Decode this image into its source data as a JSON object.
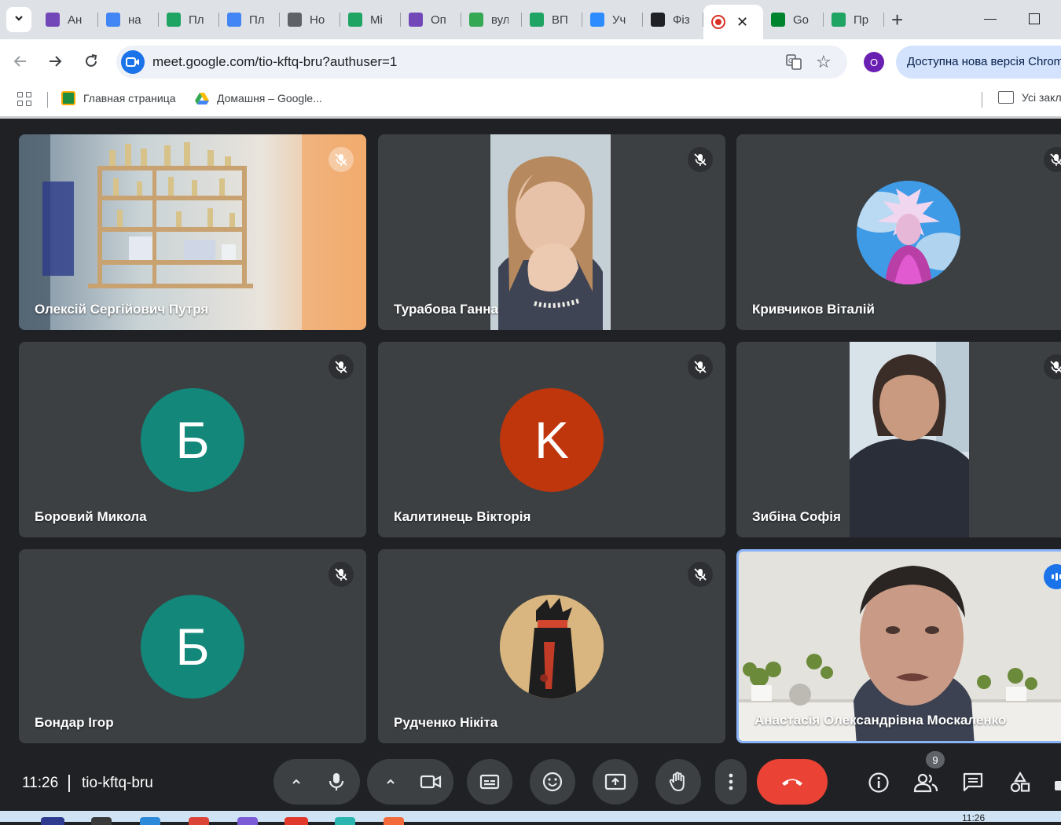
{
  "browser": {
    "tabs": [
      {
        "title": "Ан",
        "icon": "forms-icon",
        "color": "#7248b9"
      },
      {
        "title": "на",
        "icon": "google-icon",
        "color": "#4285f4"
      },
      {
        "title": "Пл",
        "icon": "drive-icon",
        "color": "#1fa463"
      },
      {
        "title": "Пл",
        "icon": "docs-icon",
        "color": "#4285f4"
      },
      {
        "title": "Но",
        "icon": "chrome-icon",
        "color": "#5f6368"
      },
      {
        "title": "Мі",
        "icon": "drive-icon",
        "color": "#1fa463"
      },
      {
        "title": "Оп",
        "icon": "forms-icon",
        "color": "#7248b9"
      },
      {
        "title": "вул",
        "icon": "maps-icon",
        "color": "#34a853"
      },
      {
        "title": "ВП",
        "icon": "drive-icon",
        "color": "#1fa463"
      },
      {
        "title": "Уч",
        "icon": "zoom-icon",
        "color": "#2d8cff"
      },
      {
        "title": "Фіз",
        "icon": "classroom-icon",
        "color": "#202124"
      }
    ],
    "active_tab": {
      "icon": "recording-icon",
      "close_label": "✕"
    },
    "tabs_after": [
      {
        "title": "Go",
        "icon": "meet-icon",
        "color": "#00832d"
      },
      {
        "title": "Пр",
        "icon": "drive-icon",
        "color": "#1fa463"
      }
    ],
    "url": "meet.google.com/tio-kftq-bru?authuser=1",
    "profile_initial": "O",
    "update_label": "Доступна нова версія Chrome",
    "bookmarks": [
      {
        "label": "Главная страница",
        "icon": "classroom-icon"
      },
      {
        "label": "Домашня – Google...",
        "icon": "drive-icon"
      }
    ],
    "bookmarks_folder": "Усі закладки"
  },
  "participants": [
    {
      "name": "Олексій Сергійович Путря",
      "type": "video",
      "muted": true
    },
    {
      "name": "Турабова Ганна",
      "type": "video",
      "muted": true
    },
    {
      "name": "Кривчиков Віталій",
      "type": "avatar-image",
      "muted": true
    },
    {
      "name": "Боровий Микола",
      "type": "initial",
      "initial": "Б",
      "color": "#12877a",
      "muted": true
    },
    {
      "name": "Калитинець Вікторія",
      "type": "initial",
      "initial": "K",
      "color": "#c0360c",
      "muted": true
    },
    {
      "name": "Зибіна Софія",
      "type": "video",
      "muted": true
    },
    {
      "name": "Бондар Ігор",
      "type": "initial",
      "initial": "Б",
      "color": "#12877a",
      "muted": true
    },
    {
      "name": "Рудченко Нікіта",
      "type": "avatar-image",
      "muted": true
    },
    {
      "name": "Анастасія Олександрівна Москаленко",
      "type": "video",
      "muted": false,
      "speaking": true
    }
  ],
  "meeting": {
    "time": "11:26",
    "code": "tio-kftq-bru",
    "people_count": "9"
  },
  "taskbar": {
    "clock": "11:26"
  },
  "colors": {
    "end_call": "#ea4335",
    "speaking_border": "#8ab4f8",
    "tile_bg": "#3c4043"
  }
}
